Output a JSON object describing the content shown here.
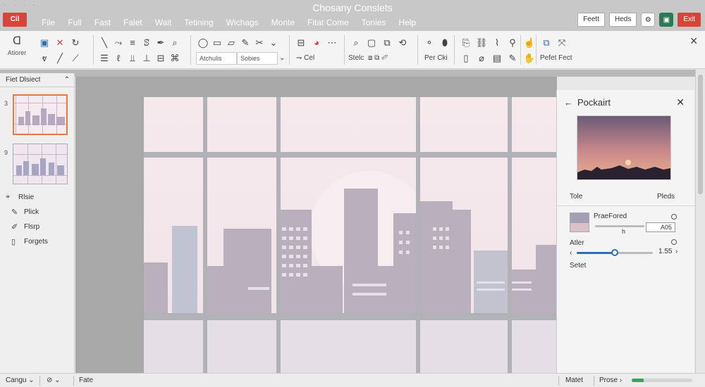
{
  "window": {
    "title": "Chosany Conslets",
    "app_button": "Cil",
    "top_glyphs": "· · · ·"
  },
  "menu": [
    "File",
    "Full",
    "Fast",
    "Falet",
    "Wait",
    "Tetining",
    "Wichags",
    "Monte",
    "Fitat Come",
    "Tonies",
    "Help"
  ],
  "titlebar_buttons": {
    "feett": "Feett",
    "heds": "Heds",
    "exit": "Exit"
  },
  "ribbon": {
    "left_label": "Atiorer",
    "font_field": "Atchulis",
    "size_field": "Sobies",
    "cil_label": "Cel",
    "steel_label": "Stelc",
    "per_label": "Per Cki",
    "pefet_label": "Pefet Fect"
  },
  "left_panel": {
    "header": "Fiet Dlsiect",
    "slides": [
      {
        "num": "3"
      },
      {
        "num": "9"
      }
    ],
    "tools": [
      {
        "label": "Rlsie",
        "icon": "select-icon"
      },
      {
        "label": "Plick",
        "icon": "pencil-icon"
      },
      {
        "label": "Flsrp",
        "icon": "pen-icon"
      },
      {
        "label": "Forgets",
        "icon": "page-icon"
      }
    ]
  },
  "right_panel": {
    "title": "Pockairt",
    "tab_left": "Tole",
    "tab_right": "Pleds",
    "row1_label": "PraeFored",
    "row1_value": "A05",
    "row1_sub": "h",
    "row2_label": "Atler",
    "row2_value": "1.55",
    "row2_slider": 0.5,
    "row3_label": "Setet"
  },
  "status_bar": {
    "item1": "Cangu",
    "item2": "Fate",
    "item3": "Matet",
    "item4": "Prose",
    "progress": 0.2
  },
  "colors": {
    "accent_red": "#d9443a",
    "accent_blue": "#2f6fb5",
    "accent_green": "#2c7a55",
    "progress_green": "#3aa35a"
  }
}
